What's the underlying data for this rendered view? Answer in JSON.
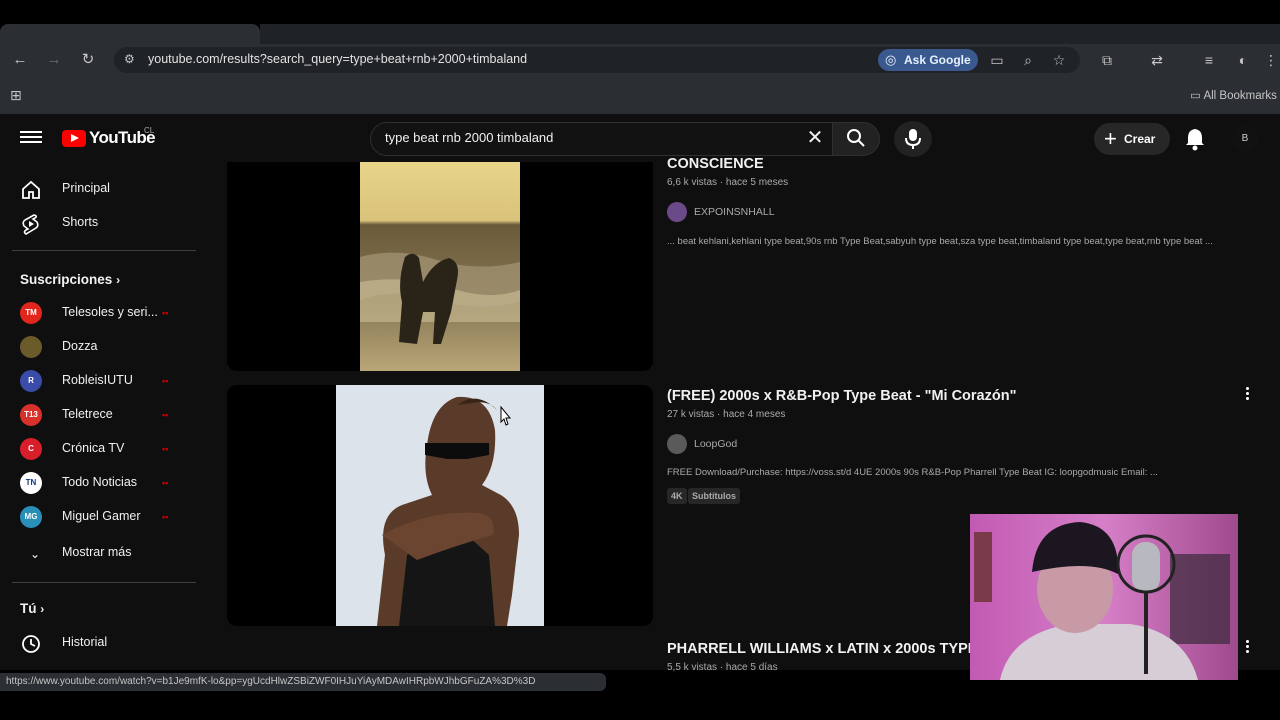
{
  "browser": {
    "url": "youtube.com/results?search_query=type+beat+rnb+2000+timbaland",
    "ask_google_label": "Ask Google",
    "all_bookmarks_label": "All Bookmarks",
    "status_bar_url": "https://www.youtube.com/watch?v=b1Je9mfK-lo&pp=ygUcdHlwZSBiZWF0IHJuYiAyMDAwIHRpbWJhbGFuZA%3D%3D"
  },
  "youtube": {
    "logo_text": "YouTube",
    "logo_country": "CL",
    "search_query": "type beat rnb 2000 timbaland",
    "create_label": "Crear",
    "avatar_initial": "B"
  },
  "sidebar": {
    "main_items": [
      {
        "label": "Principal",
        "icon": "home-icon"
      },
      {
        "label": "Shorts",
        "icon": "shorts-icon"
      }
    ],
    "subscriptions_heading": "Suscripciones",
    "subscriptions": [
      {
        "name": "Telesoles y seri...",
        "color": "#e0261d",
        "initials": "TM",
        "live": true
      },
      {
        "name": "Dozza",
        "color": "#6b5a2a",
        "initials": "",
        "live": false
      },
      {
        "name": "RobleisIUTU",
        "color": "#3a4ca8",
        "initials": "R",
        "live": true
      },
      {
        "name": "Teletrece",
        "color": "#d8302a",
        "initials": "T13",
        "live": true
      },
      {
        "name": "Crónica TV",
        "color": "#d81e2a",
        "initials": "C",
        "live": true
      },
      {
        "name": "Todo Noticias",
        "color": "#ffffff",
        "initials": "TN",
        "live": true
      },
      {
        "name": "Miguel Gamer",
        "color": "#2a8fb8",
        "initials": "MG",
        "live": true
      }
    ],
    "show_more_label": "Mostrar más",
    "you_heading": "Tú",
    "history_label": "Historial",
    "live_marker": "••"
  },
  "results": [
    {
      "title": "CONSCIENCE",
      "meta": "6,6 k vistas · hace 5 meses",
      "channel": "EXPOINSNHALL",
      "description": "... beat kehlani,kehlani type beat,90s rnb Type Beat,sabyuh type beat,sza type beat,timbaland type beat,type beat,rnb type beat ..."
    },
    {
      "title": "(FREE) 2000s x R&B-Pop Type Beat - \"Mi Corazón\"",
      "meta": "27 k vistas · hace 4 meses",
      "channel": "LoopGod",
      "description": "FREE Download/Purchase: https://voss.st/d 4UE 2000s 90s R&B-Pop Pharrell Type Beat IG: loopgodmusic Email: ...",
      "badges": [
        "4K",
        "Subtítulos"
      ]
    },
    {
      "title": "PHARRELL WILLIAMS x LATIN x 2000s TYPE",
      "meta": "5,5 k vistas · hace 5 días"
    }
  ]
}
